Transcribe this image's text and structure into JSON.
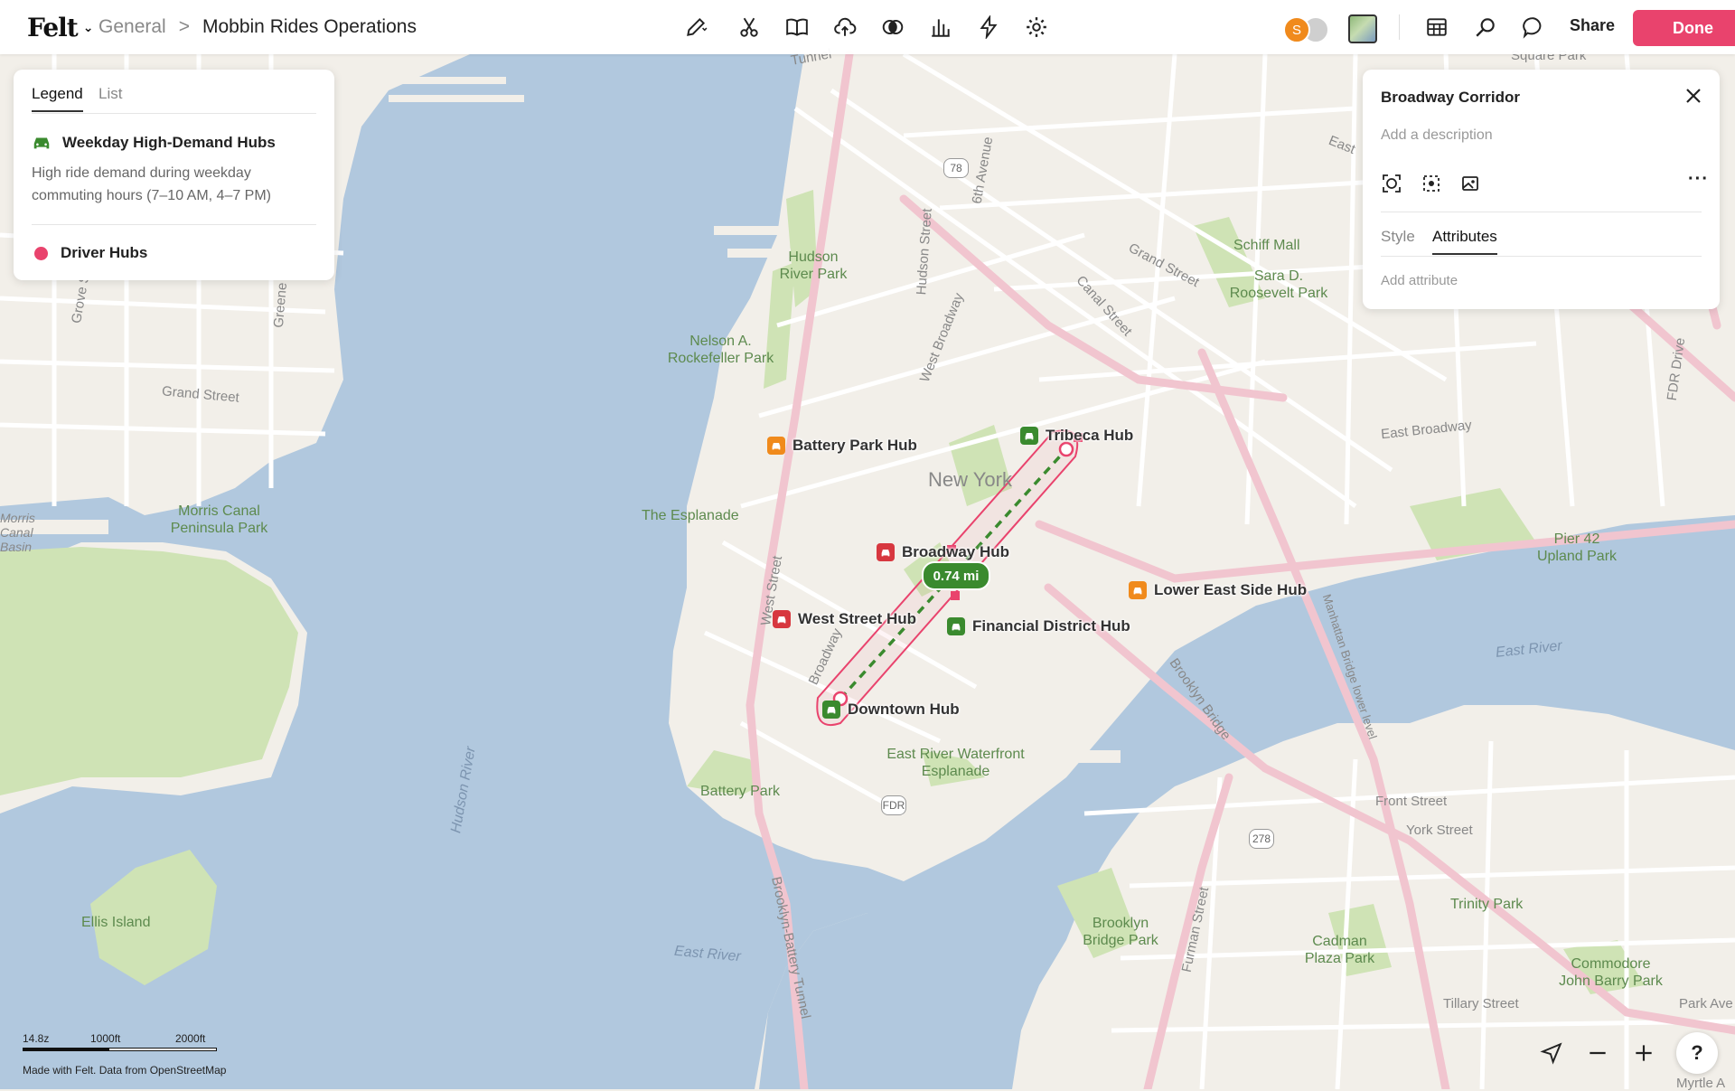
{
  "app": {
    "logo": "Felt",
    "breadcrumb_parent": "General",
    "breadcrumb_sep": ">",
    "map_title": "Mobbin Rides Operations",
    "avatar_initial": "S",
    "share_label": "Share",
    "done_label": "Done"
  },
  "legend": {
    "tabs": [
      {
        "label": "Legend"
      },
      {
        "label": "List"
      }
    ],
    "layers": [
      {
        "name": "Weekday High-Demand Hubs",
        "description": "High ride demand during weekday commuting hours (7–10 AM, 4–7 PM)",
        "icon": "car-icon",
        "color": "#3a8a2e"
      },
      {
        "name": "Driver Hubs",
        "icon": "dot-icon",
        "color": "#e9436d"
      }
    ]
  },
  "detail": {
    "title": "Broadway Corridor",
    "description_placeholder": "Add a description",
    "tabs": [
      {
        "label": "Style"
      },
      {
        "label": "Attributes"
      }
    ],
    "active_tab": "Attributes",
    "add_attribute": "Add attribute"
  },
  "map": {
    "city_label": "New York",
    "measure_label": "0.74 mi",
    "colors": {
      "water": "#b1c8de",
      "land": "#f2efe9",
      "park": "#cfe3b5",
      "road": "#ffffff",
      "highway": "#f1c5cf",
      "accent": "#e9436d",
      "green": "#3a8a2e",
      "orange": "#f08a1c",
      "red": "#d7373f"
    },
    "hubs": [
      {
        "name": "Tribeca Hub",
        "color": "#3a8a2e"
      },
      {
        "name": "Battery Park Hub",
        "color": "#f08a1c"
      },
      {
        "name": "Broadway Hub",
        "color": "#d7373f"
      },
      {
        "name": "West Street Hub",
        "color": "#d7373f"
      },
      {
        "name": "Financial District Hub",
        "color": "#3a8a2e"
      },
      {
        "name": "Lower East Side Hub",
        "color": "#f08a1c"
      },
      {
        "name": "Downtown Hub",
        "color": "#3a8a2e"
      }
    ],
    "parks": [
      "Hudson River Park",
      "Nelson A. Rockefeller Park",
      "The Esplanade",
      "Schiff Mall",
      "Sara D. Roosevelt Park",
      "Morris Canal Peninsula Park",
      "Pier 42 Upland Park",
      "East River Waterfront Esplanade",
      "Battery Park",
      "Ellis Island",
      "Brooklyn Bridge Park",
      "Cadman Plaza Park",
      "Trinity Park",
      "Commodore John Barry Park"
    ],
    "streets": [
      "Grand Street",
      "Grand Street",
      "6th Avenue",
      "Hudson Street",
      "West Broadway",
      "Canal Street",
      "East Broadway",
      "FDR Drive",
      "Grove St",
      "Greene St",
      "West Street",
      "Broadway",
      "Manhattan Bridge lower level",
      "Brooklyn Bridge",
      "Front Street",
      "York Street",
      "Tillary Street",
      "Furman Street",
      "Brooklyn-Battery Tunnel",
      "Park Ave",
      "Myrtle A",
      "Square Park",
      "Tunnel",
      "Morris Canal Basin",
      "East "
    ],
    "water": [
      "Hudson River",
      "East River",
      "East River"
    ],
    "shields": [
      "78",
      "FDR",
      "278"
    ]
  },
  "footer": {
    "zoom": "14.8z",
    "scale_1": "1000ft",
    "scale_2": "2000ft",
    "attribution": "Made with Felt. Data from OpenStreetMap"
  }
}
